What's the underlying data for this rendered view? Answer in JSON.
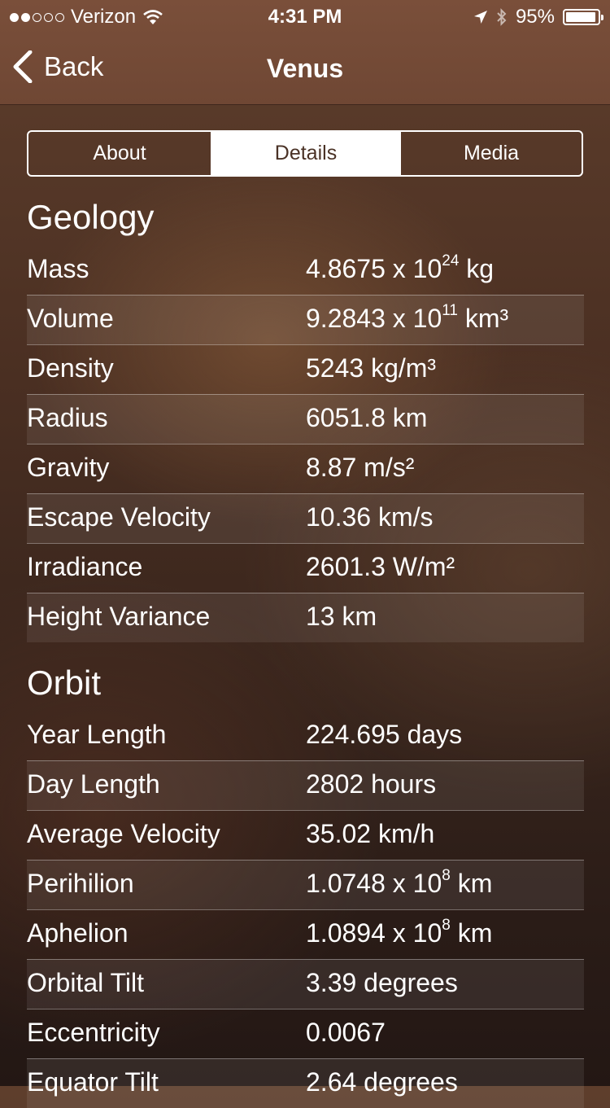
{
  "status_bar": {
    "carrier": "Verizon",
    "time": "4:31 PM",
    "battery": "95%",
    "battery_level": 0.95
  },
  "nav": {
    "back_label": "Back",
    "title": "Venus"
  },
  "tabs": [
    {
      "label": "About",
      "active": false
    },
    {
      "label": "Details",
      "active": true
    },
    {
      "label": "Media",
      "active": false
    }
  ],
  "geology": {
    "title": "Geology",
    "rows": [
      {
        "label": "Mass",
        "value": "4.8675 x 10",
        "sup": "24",
        "unit": " kg"
      },
      {
        "label": "Volume",
        "value": "9.2843 x 10",
        "sup": "11",
        "unit": " km³"
      },
      {
        "label": "Density",
        "value": "5243 kg/m³"
      },
      {
        "label": "Radius",
        "value": "6051.8 km"
      },
      {
        "label": "Gravity",
        "value": "8.87 m/s²"
      },
      {
        "label": "Escape Velocity",
        "value": "10.36 km/s"
      },
      {
        "label": "Irradiance",
        "value": "2601.3 W/m²"
      },
      {
        "label": "Height Variance",
        "value": "13 km"
      }
    ]
  },
  "orbit": {
    "title": "Orbit",
    "rows": [
      {
        "label": "Year Length",
        "value": "224.695 days"
      },
      {
        "label": "Day Length",
        "value": "2802 hours"
      },
      {
        "label": "Average Velocity",
        "value": "35.02 km/h"
      },
      {
        "label": "Perihilion",
        "value": "1.0748 x 10",
        "sup": "8",
        "unit": " km"
      },
      {
        "label": "Aphelion",
        "value": "1.0894 x 10",
        "sup": "8",
        "unit": " km"
      },
      {
        "label": "Orbital Tilt",
        "value": "3.39 degrees"
      },
      {
        "label": "Eccentricity",
        "value": "0.0067"
      },
      {
        "label": "Equator Tilt",
        "value": "2.64 degrees"
      }
    ]
  }
}
